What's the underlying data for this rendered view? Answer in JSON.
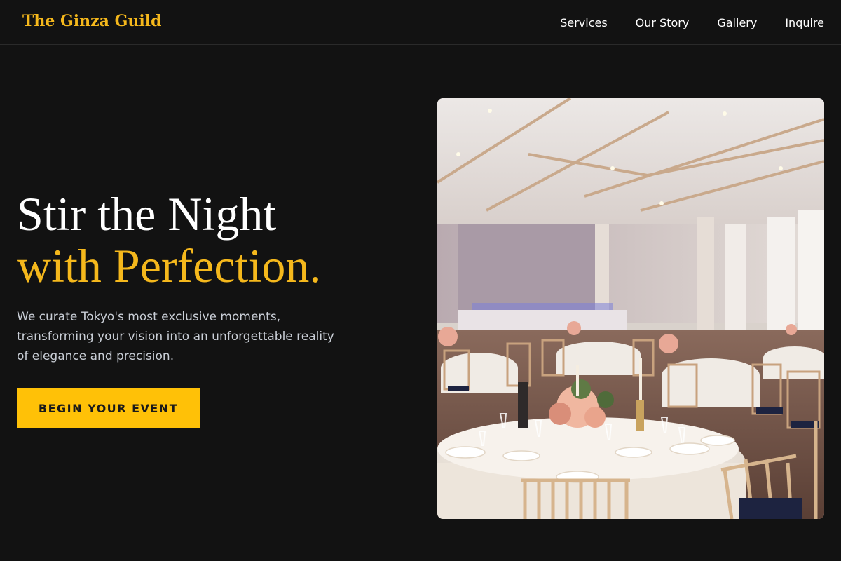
{
  "header": {
    "brand": "The Ginza Guild",
    "nav": [
      {
        "label": "Services"
      },
      {
        "label": "Our Story"
      },
      {
        "label": "Gallery"
      },
      {
        "label": "Inquire"
      }
    ]
  },
  "hero": {
    "title_line1": "Stir the Night",
    "title_line2": "with Perfection.",
    "description": "We curate Tokyo's most exclusive moments, transforming your vision into an unforgettable reality of elegance and precision.",
    "cta_label": "BEGIN YOUR EVENT"
  },
  "colors": {
    "background": "#121212",
    "accent": "#f5b81c",
    "button": "#ffc107",
    "text_muted": "#c9ced6"
  }
}
